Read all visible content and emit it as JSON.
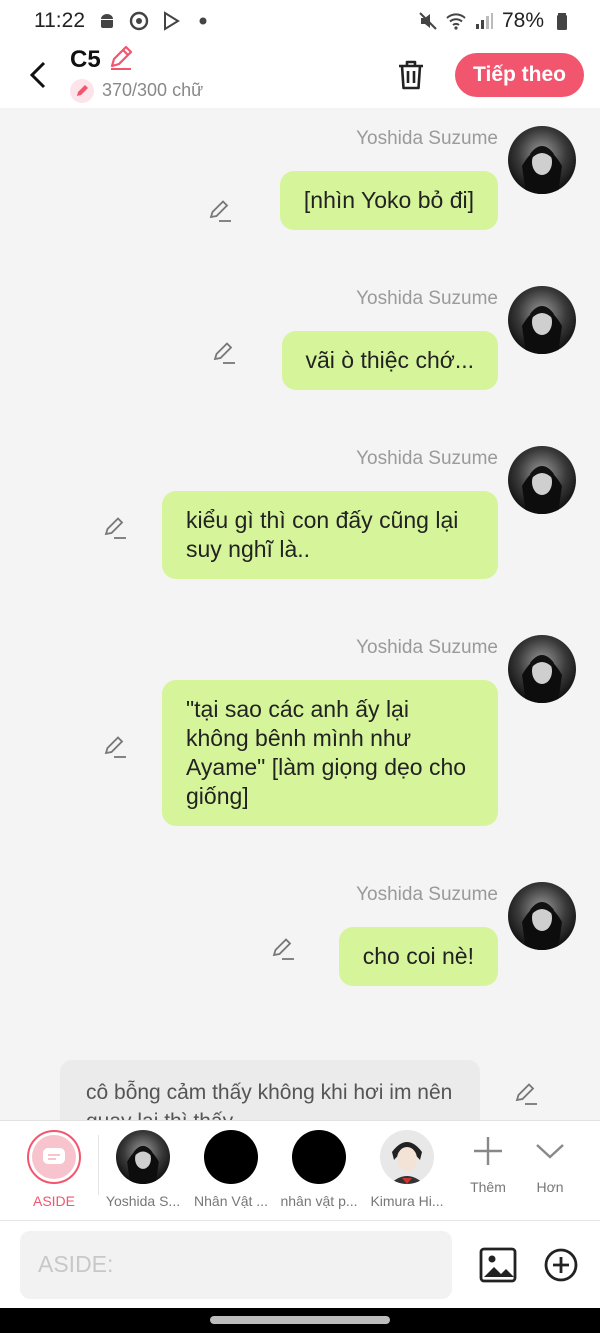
{
  "status_bar": {
    "time": "11:22",
    "battery": "78%"
  },
  "header": {
    "title": "C5",
    "char_count": "370/300 chữ",
    "next_label": "Tiếp theo"
  },
  "messages": [
    {
      "sender": "Yoshida Suzume",
      "text": "[nhìn Yoko bỏ đi]"
    },
    {
      "sender": "Yoshida Suzume",
      "text": "vãi ò thiệc chớ..."
    },
    {
      "sender": "Yoshida Suzume",
      "text": "kiểu gì thì con đấy cũng lại suy nghĩ là.."
    },
    {
      "sender": "Yoshida Suzume",
      "text": "\"tại sao các anh ấy lại không bênh mình như Ayame\" [làm giọng dẹo cho giống]"
    },
    {
      "sender": "Yoshida Suzume",
      "text": "cho coi nè!"
    }
  ],
  "narration": {
    "text": "cô bỗng cảm thấy không khi hơi im nên quay lại thì thấy"
  },
  "characters": {
    "aside": "ASIDE",
    "items": [
      "Yoshida S...",
      "Nhân Vật ...",
      "nhân vật p...",
      "Kimura Hi..."
    ],
    "add_label": "Thêm",
    "more_label": "Hơn"
  },
  "input": {
    "placeholder": "ASIDE:"
  },
  "colors": {
    "accent": "#f2566f",
    "bubble": "#d6f59a",
    "background": "#f4f4f4"
  }
}
